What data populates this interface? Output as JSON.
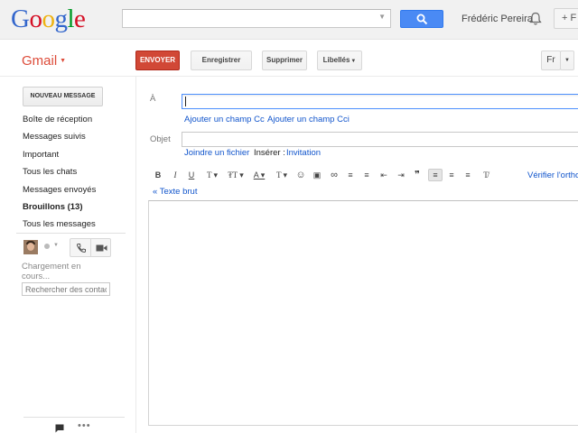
{
  "google": {
    "logo_letters": [
      "G",
      "o",
      "o",
      "g",
      "l",
      "e"
    ],
    "user_name": "Frédéric Pereira",
    "share_label": "+ F"
  },
  "gmail": {
    "label": "Gmail",
    "toolbar": {
      "send": "ENVOYER",
      "save": "Enregistrer",
      "delete": "Supprimer",
      "labels": "Libellés",
      "language": "Fr"
    }
  },
  "sidebar": {
    "compose": "NOUVEAU MESSAGE",
    "items": [
      {
        "label": "Boîte de réception",
        "bold": false
      },
      {
        "label": "Messages suivis",
        "bold": false
      },
      {
        "label": "Important",
        "bold": false
      },
      {
        "label": "Tous les chats",
        "bold": false
      },
      {
        "label": "Messages envoyés",
        "bold": false
      },
      {
        "label": "Brouillons (13)",
        "bold": true
      },
      {
        "label": "Tous les messages",
        "bold": false
      }
    ],
    "loading": "Chargement en cours...",
    "contact_search_placeholder": "Rechercher des contacts"
  },
  "compose": {
    "to_label": "À",
    "add_cc": "Ajouter un champ Cc",
    "add_bcc": "Ajouter un champ Cci",
    "subject_label": "Objet",
    "attach": "Joindre un fichier",
    "insert_label": "Insérer :",
    "invitation": "Invitation",
    "plain_text": "« Texte brut",
    "spellcheck": "Vérifier l'orthographe",
    "format_tools": [
      {
        "name": "bold-button",
        "glyph": "B",
        "active": false
      },
      {
        "name": "italic-button",
        "glyph": "I",
        "active": false
      },
      {
        "name": "underline-button",
        "glyph": "U",
        "active": false
      },
      {
        "name": "font-button",
        "glyph": "T ▾",
        "active": false
      },
      {
        "name": "font-size-button",
        "glyph": "₮T ▾",
        "active": false
      },
      {
        "name": "text-color-button",
        "glyph": "A ▾",
        "active": false
      },
      {
        "name": "highlight-button",
        "glyph": "T ▾",
        "active": false
      },
      {
        "name": "emoji-button",
        "glyph": "☺",
        "active": false
      },
      {
        "name": "insert-image-button",
        "glyph": "▣",
        "active": false
      },
      {
        "name": "insert-link-button",
        "glyph": "∞",
        "active": false
      },
      {
        "name": "numbered-list-button",
        "glyph": "≡",
        "active": false
      },
      {
        "name": "bullet-list-button",
        "glyph": "≡",
        "active": false
      },
      {
        "name": "indent-less-button",
        "glyph": "⇤",
        "active": false
      },
      {
        "name": "indent-more-button",
        "glyph": "⇥",
        "active": false
      },
      {
        "name": "quote-button",
        "glyph": "❞",
        "active": false
      },
      {
        "name": "align-left-button",
        "glyph": "≡",
        "active": true
      },
      {
        "name": "align-center-button",
        "glyph": "≡",
        "active": false
      },
      {
        "name": "align-right-button",
        "glyph": "≡",
        "active": false
      },
      {
        "name": "remove-format-button",
        "glyph": "T̸",
        "active": false
      }
    ]
  }
}
